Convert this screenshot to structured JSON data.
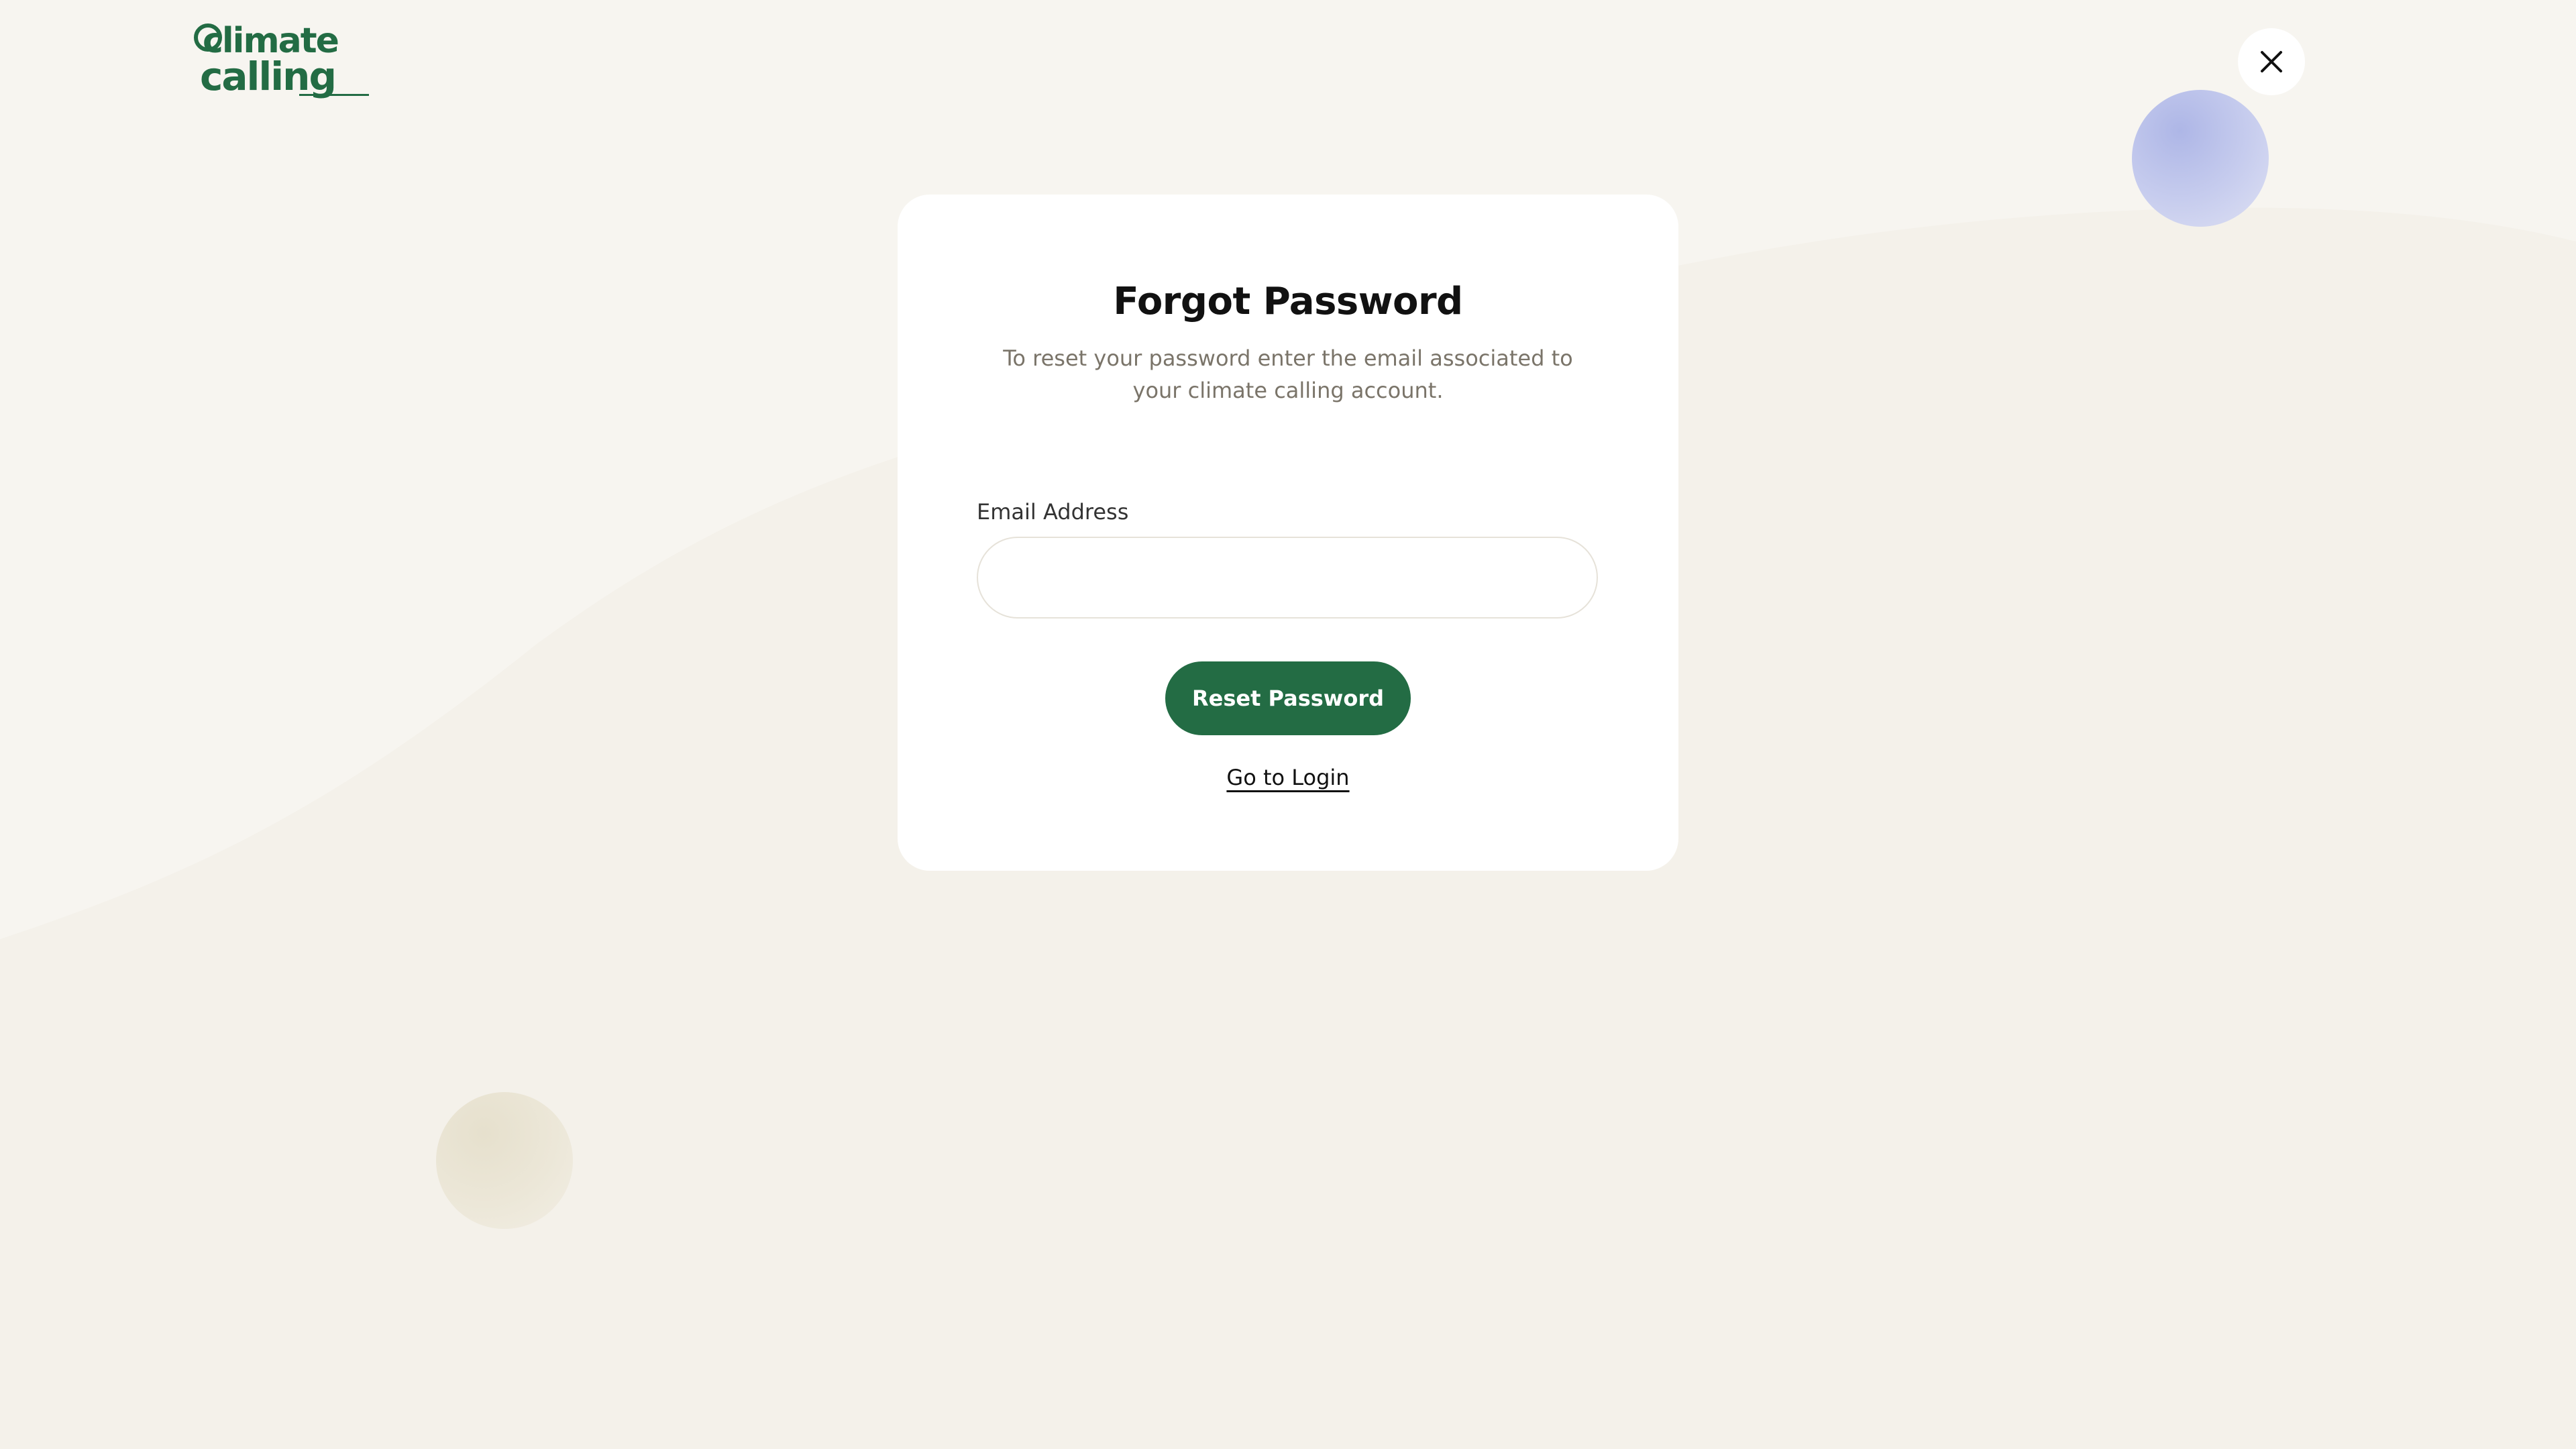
{
  "header": {
    "logo": {
      "line1": "climate",
      "line2": "calling",
      "brand_color": "#236c44",
      "icon": "climate-calling-logo"
    },
    "close_icon": "close-icon"
  },
  "modal": {
    "title": "Forgot Password",
    "subtitle": "To reset your password enter the email associated to your climate calling account.",
    "email_label": "Email Address",
    "email_value": "",
    "email_placeholder": "",
    "reset_button_label": "Reset Password",
    "login_link_label": "Go to Login"
  },
  "colors": {
    "accent": "#236c44",
    "background": "#f7f5f0",
    "card": "#ffffff",
    "muted_text": "#7a7469",
    "orb_purple": "#bcc3ec",
    "orb_cream": "#ebe6d6"
  }
}
